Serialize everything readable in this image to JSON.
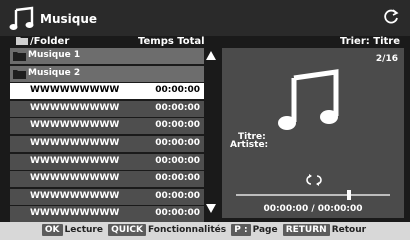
{
  "app": {
    "title": "Musique",
    "icon": "music-note-icon",
    "refresh_icon": "refresh-icon"
  },
  "columns": {
    "folder": "/Folder",
    "total": "Temps Total",
    "sort": "Trier: Titre"
  },
  "list": {
    "folders": [
      {
        "label": "Musique 1"
      },
      {
        "label": "Musique 2"
      }
    ],
    "tracks": [
      {
        "name": "WWWWWWWWW",
        "time": "00:00:00",
        "selected": true
      },
      {
        "name": "WWWWWWWWW",
        "time": "00:00:00"
      },
      {
        "name": "WWWWWWWWW",
        "time": "00:00:00"
      },
      {
        "name": "WWWWWWWWW",
        "time": "00:00:00"
      },
      {
        "name": "WWWWWWWWW",
        "time": "00:00:00"
      },
      {
        "name": "WWWWWWWWW",
        "time": "00:00:00"
      },
      {
        "name": "WWWWWWWWW",
        "time": "00:00:00"
      },
      {
        "name": "WWWWWWWWW",
        "time": "00:00:00"
      }
    ]
  },
  "panel": {
    "counter": "2/16",
    "title_label": "Titre:",
    "artist_label": "Artiste:",
    "time_readout": "00:00:00 / 00:00:00",
    "progress": 0.72
  },
  "footer": [
    {
      "key": "OK",
      "label": "Lecture"
    },
    {
      "key": "QUICK",
      "label": "Fonctionnalités"
    },
    {
      "key": "P :",
      "label": "Page"
    },
    {
      "key": "RETURN",
      "label": "Retour"
    }
  ],
  "colors": {
    "selected_row": "#ffffff",
    "row": "#4e4e4e",
    "folder_row": "#6d6d6d",
    "panel": "#4b4b4b"
  }
}
